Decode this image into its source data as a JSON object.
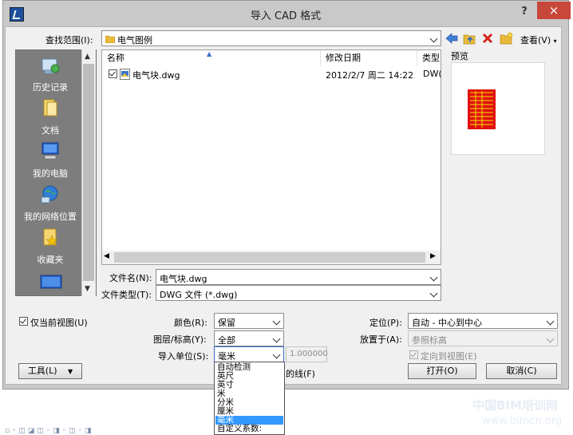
{
  "window": {
    "title": "导入 CAD 格式",
    "help_label": "?",
    "close_label": "×"
  },
  "lookin": {
    "label": "查找范围(I):",
    "value": "电气图例",
    "views_label": "查看(V)"
  },
  "places": [
    {
      "label": "历史记录",
      "icon": "history-icon"
    },
    {
      "label": "文档",
      "icon": "documents-icon"
    },
    {
      "label": "我的电脑",
      "icon": "computer-icon"
    },
    {
      "label": "我的网络位置",
      "icon": "network-icon"
    },
    {
      "label": "收藏夹",
      "icon": "favorites-icon"
    }
  ],
  "filelist": {
    "columns": [
      "名称",
      "修改日期",
      "类型"
    ],
    "rows": [
      {
        "name": "电气块.dwg",
        "modified": "2012/2/7 周二 14:22",
        "type": "DW(",
        "checked": true
      }
    ]
  },
  "preview": {
    "label": "预览"
  },
  "filename": {
    "label": "文件名(N):",
    "value": "电气块.dwg"
  },
  "filetype": {
    "label": "文件类型(T):",
    "value": "DWG 文件 (*.dwg)"
  },
  "options": {
    "current_view_label": "仅当前视图(U)",
    "current_view_checked": true,
    "color_label": "颜色(R):",
    "color_value": "保留",
    "layers_label": "图层/标高(Y):",
    "layers_value": "全部",
    "units_label": "导入单位(S):",
    "units_value": "毫米",
    "scale_value": "1.000000",
    "positioning_label": "定位(P):",
    "positioning_value": "自动 - 中心到中心",
    "place_at_label": "放置于(A):",
    "place_at_value": "参照标高",
    "orient_label": "定向到视图(E)",
    "orient_checked": true,
    "correct_lines_label": "的线(F)"
  },
  "units_dropdown": {
    "items": [
      "自动检测",
      "英尺",
      "英寸",
      "米",
      "分米",
      "厘米",
      "毫米",
      "自定义系数:"
    ],
    "selected_index": 6
  },
  "buttons": {
    "tools_label": "工具(L)",
    "open_label": "打开(O)",
    "cancel_label": "取消(C)"
  },
  "watermark": {
    "line1": "中国BIM培训网",
    "line2": "www.bimcn.org"
  },
  "colors": {
    "accent_selection": "#3399ff",
    "close_button": "#c7483b",
    "places_bg": "#7d7d7d"
  }
}
